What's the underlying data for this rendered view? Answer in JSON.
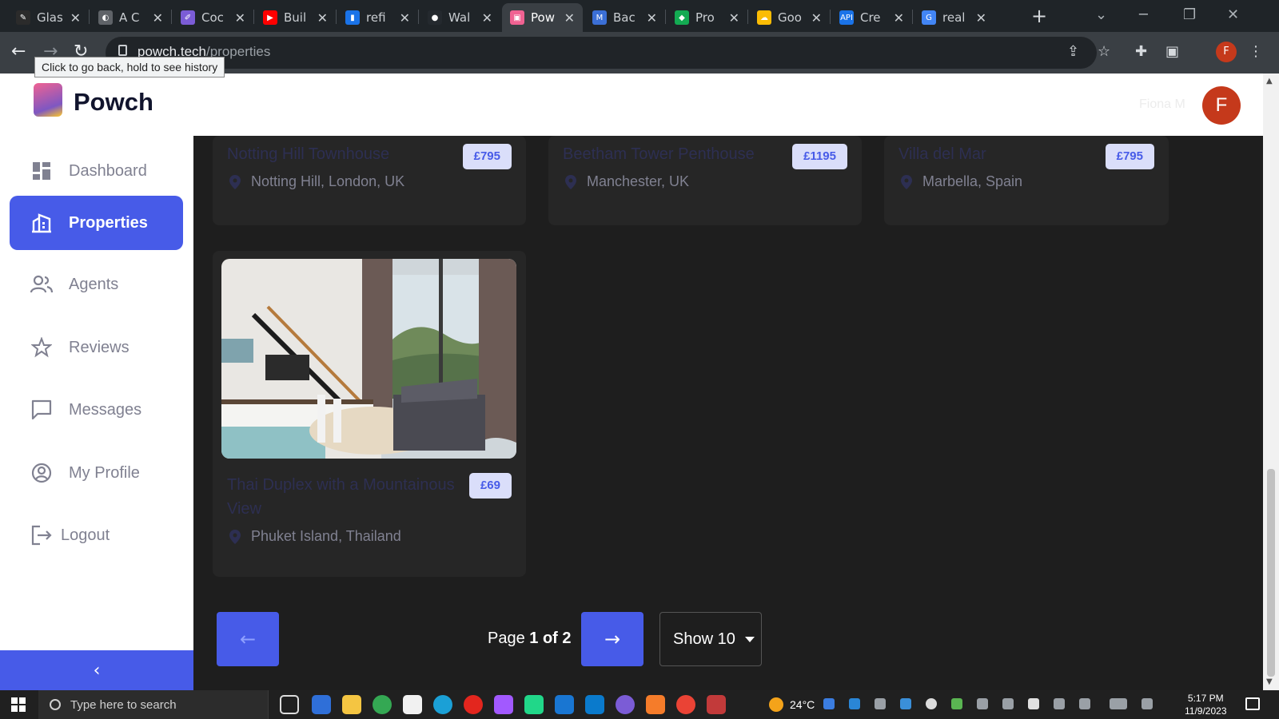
{
  "browser": {
    "tabs": [
      {
        "title": "Glas",
        "color": "#2b2b2b",
        "glyph": "✎"
      },
      {
        "title": "A C",
        "color": "#5f6368",
        "glyph": "◐"
      },
      {
        "title": "Coc",
        "color": "#7b5cd6",
        "glyph": "✐"
      },
      {
        "title": "Buil",
        "color": "#ff0000",
        "glyph": "▶"
      },
      {
        "title": "refi",
        "color": "#1a73e8",
        "glyph": "▮"
      },
      {
        "title": "Wal",
        "color": "#24292e",
        "glyph": "●"
      },
      {
        "title": "Pow",
        "color": "#f06292",
        "glyph": "▣"
      },
      {
        "title": "Bac",
        "color": "#3b6fd6",
        "glyph": "M"
      },
      {
        "title": "Pro",
        "color": "#13aa52",
        "glyph": "◆"
      },
      {
        "title": "Goo",
        "color": "#fbbc04",
        "glyph": "☁"
      },
      {
        "title": "Cre",
        "color": "#1a73e8",
        "glyph": "API"
      },
      {
        "title": "real",
        "color": "#4285f4",
        "glyph": "G"
      }
    ],
    "active_tab_index": 6,
    "url_host": "powch.tech",
    "url_path": "/properties",
    "tooltip": "Click to go back, hold to see history",
    "profile_initial": "F"
  },
  "app": {
    "logo_text": "Powch",
    "user_name": "Fiona M",
    "user_initial": "F",
    "accent": "#475be8",
    "nav": [
      {
        "label": "Dashboard",
        "icon": "dashboard-icon",
        "active": false
      },
      {
        "label": "Properties",
        "icon": "properties-icon",
        "active": true
      },
      {
        "label": "Agents",
        "icon": "agents-icon",
        "active": false
      },
      {
        "label": "Reviews",
        "icon": "star-icon",
        "active": false
      },
      {
        "label": "Messages",
        "icon": "message-icon",
        "active": false
      },
      {
        "label": "My Profile",
        "icon": "profile-icon",
        "active": false
      },
      {
        "label": "Logout",
        "icon": "logout-icon",
        "active": false
      }
    ],
    "collapse_glyph": "‹"
  },
  "properties": [
    {
      "title": "Notting Hill Townhouse",
      "price": "£795",
      "location": "Notting Hill, London, UK"
    },
    {
      "title": "Beetham Tower Penthouse",
      "price": "£1195",
      "location": "Manchester, UK"
    },
    {
      "title": "Villa del Mar",
      "price": "£795",
      "location": "Marbella, Spain"
    },
    {
      "title": "Thai Duplex with a Mountainous View",
      "price": "£69",
      "location": "Phuket Island, Thailand"
    }
  ],
  "pagination": {
    "prev_label": "←",
    "next_label": "→",
    "page_prefix": "Page",
    "page_value": "1 of 2",
    "show_label": "Show 10"
  },
  "taskbar": {
    "search_placeholder": "Type here to search",
    "weather": "24°C",
    "time": "5:17 PM",
    "date": "11/9/2023"
  }
}
